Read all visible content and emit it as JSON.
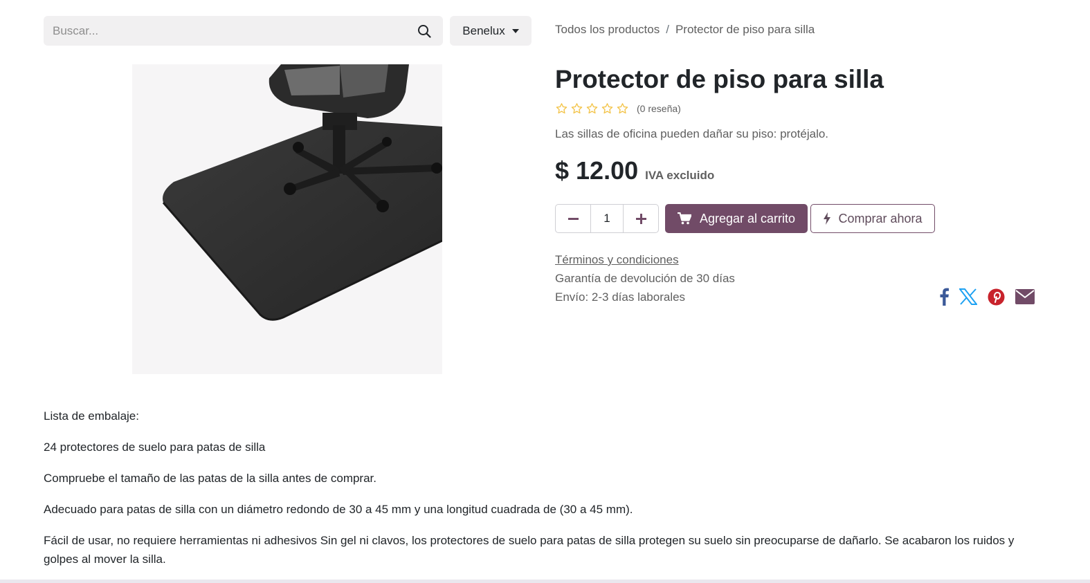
{
  "search": {
    "placeholder": "Buscar..."
  },
  "pricelist": {
    "label": "Benelux"
  },
  "breadcrumb": {
    "items": [
      "Todos los productos",
      "Protector de piso para silla"
    ],
    "separator": "/"
  },
  "product": {
    "title": "Protector de piso para silla",
    "review_count": "(0 reseña)",
    "rating": 0,
    "subtitle": "Las sillas de oficina pueden dañar su piso: protéjalo.",
    "price": "$ 12.00",
    "tax_note": "IVA excluido",
    "quantity": "1",
    "add_to_cart_label": "Agregar al carrito",
    "buy_now_label": "Comprar ahora",
    "terms_link": "Términos y condiciones",
    "guarantee": "Garantía de devolución de 30 días",
    "shipping": "Envío: 2-3 días laborales"
  },
  "share_icons": [
    "facebook-icon",
    "x-twitter-icon",
    "pinterest-icon",
    "envelope-icon"
  ],
  "description": [
    "Lista de embalaje:",
    "24 protectores de suelo para patas de silla",
    "Compruebe el tamaño de las patas de la silla antes de comprar.",
    "Adecuado para patas de silla con un diámetro redondo de 30 a 45 mm y una longitud cuadrada de (30 a 45 mm).",
    "Fácil de usar, no requiere herramientas ni adhesivos Sin gel ni clavos, los protectores de suelo para patas de silla protegen su suelo sin preocuparse de dañarlo. Se acabaron los ruidos y golpes al mover la silla."
  ],
  "colors": {
    "primary": "#714b67",
    "star": "#f3c44a",
    "facebook": "#3b5998",
    "x": "#1da1f2",
    "pinterest": "#c8232c",
    "email": "#714b67"
  }
}
